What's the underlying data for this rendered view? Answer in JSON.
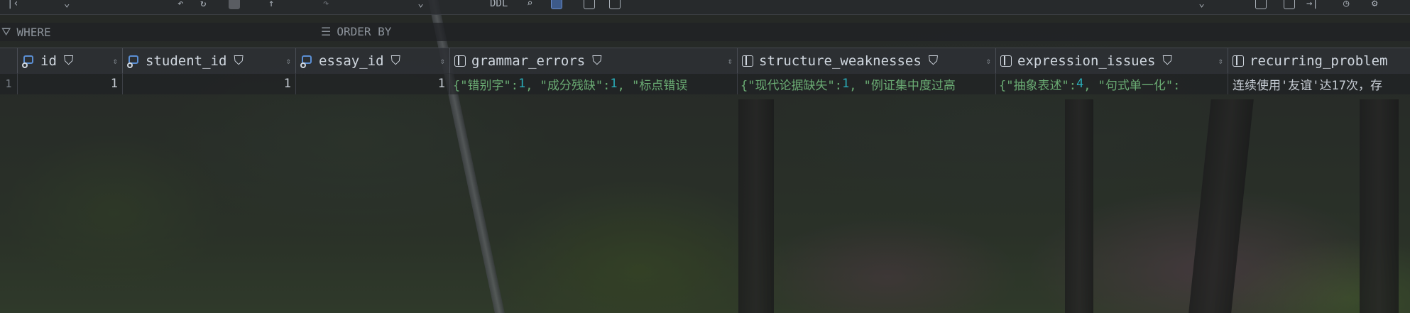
{
  "filter": {
    "where_label": "WHERE",
    "order_label": "ORDER BY"
  },
  "toolbar": {
    "view_mode": "",
    "ddl_label": "DDL",
    "export_format": ""
  },
  "columns": [
    {
      "label": "id",
      "key": true
    },
    {
      "label": "student_id",
      "key": true
    },
    {
      "label": "essay_id",
      "key": true
    },
    {
      "label": "grammar_errors",
      "key": false
    },
    {
      "label": "structure_weaknesses",
      "key": false
    },
    {
      "label": "expression_issues",
      "key": false
    },
    {
      "label": "recurring_problem",
      "key": false
    }
  ],
  "rows": [
    {
      "row_number": "1",
      "id": "1",
      "student_id": "1",
      "essay_id": "1",
      "grammar_errors": {
        "k1": "{\"错别字\": ",
        "v1": "1",
        "k2": ", \"成分残缺\": ",
        "v2": "1",
        "k3": ", \"标点错误"
      },
      "structure_weaknesses": {
        "k1": "{\"现代论据缺失\": ",
        "v1": "1",
        "k2": ", \"例证集中度过高"
      },
      "expression_issues": {
        "k1": "{\"抽象表述\": ",
        "v1": "4",
        "k2": ", \"句式单一化\": "
      },
      "recurring_problem": "连续使用'友谊'达17次，存"
    }
  ]
}
